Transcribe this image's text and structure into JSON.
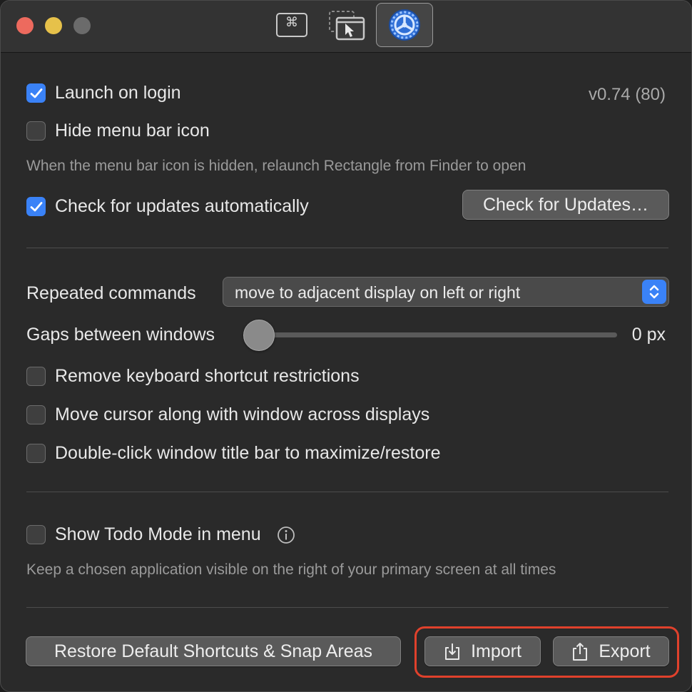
{
  "window": {
    "tabs": [
      {
        "name": "Keyboard Shortcuts",
        "icon": "command-key-icon",
        "glyph": "⌘",
        "selected": false
      },
      {
        "name": "Snap Areas",
        "icon": "snap-area-cursor-icon",
        "selected": false
      },
      {
        "name": "General",
        "icon": "gear-icon",
        "selected": true
      }
    ]
  },
  "general": {
    "launch_on_login": {
      "label": "Launch on login",
      "checked": true
    },
    "version": "v0.74 (80)",
    "hide_menu_bar_icon": {
      "label": "Hide menu bar icon",
      "checked": false
    },
    "hidden_icon_note": "When the menu bar icon is hidden, relaunch Rectangle from Finder to open",
    "check_updates_auto": {
      "label": "Check for updates automatically",
      "checked": true
    },
    "check_updates_button": "Check for Updates…"
  },
  "behavior": {
    "repeated_commands_label": "Repeated commands",
    "repeated_commands_value": "move to adjacent display on left or right",
    "gaps_label": "Gaps between windows",
    "gaps_value": "0 px",
    "gaps_level": 0,
    "remove_shortcut_restrictions": {
      "label": "Remove keyboard shortcut restrictions",
      "checked": false
    },
    "move_cursor": {
      "label": "Move cursor along with window across displays",
      "checked": false
    },
    "double_click_title": {
      "label": "Double-click window title bar to maximize/restore",
      "checked": false
    }
  },
  "todo": {
    "show_todo_mode": {
      "label": "Show Todo Mode in menu",
      "checked": false
    },
    "note": "Keep a chosen application visible on the right of your primary screen at all times"
  },
  "footer": {
    "restore_button": "Restore Default Shortcuts & Snap Areas",
    "import_button": "Import",
    "export_button": "Export"
  },
  "colors": {
    "accent": "#3a82f7",
    "highlight": "#e0412c",
    "close": "#ed6a5e",
    "minimize": "#e6c14a"
  }
}
